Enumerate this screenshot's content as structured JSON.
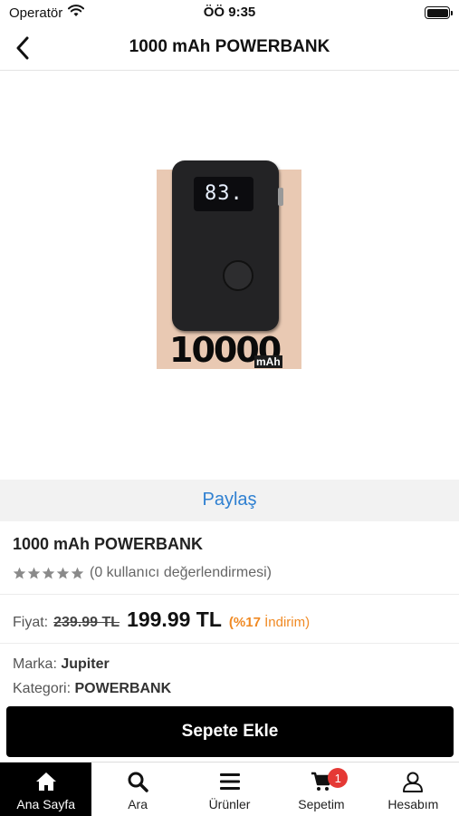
{
  "status_bar": {
    "carrier": "Operatör",
    "time": "ÖÖ 9:35"
  },
  "nav": {
    "title": "1000 mAh POWERBANK"
  },
  "product_image": {
    "display_reading": "83.",
    "box_text": "10000",
    "box_unit": "mAh"
  },
  "share": {
    "label": "Paylaş"
  },
  "product": {
    "name": "1000 mAh POWERBANK",
    "rating_text": "(0 kullanıcı değerlendirmesi)",
    "stars_filled": 0,
    "stars_total": 5,
    "price_label": "Fiyat:",
    "old_price": "239.99 TL",
    "new_price": "199.99 TL",
    "discount_percent": "(%17",
    "discount_word": "İndirim)",
    "brand_label": "Marka:",
    "brand": "Jupiter",
    "category_label": "Kategori:",
    "category": "POWERBANK"
  },
  "actions": {
    "add_to_cart": "Sepete Ekle"
  },
  "tabs": [
    {
      "label": "Ana Sayfa",
      "icon": "home-icon",
      "active": true
    },
    {
      "label": "Ara",
      "icon": "search-icon",
      "active": false
    },
    {
      "label": "Ürünler",
      "icon": "menu-icon",
      "active": false
    },
    {
      "label": "Sepetim",
      "icon": "cart-icon",
      "active": false,
      "badge": "1"
    },
    {
      "label": "Hesabım",
      "icon": "user-icon",
      "active": false
    }
  ],
  "colors": {
    "accent_link": "#2f80d1",
    "discount": "#f08a24",
    "badge": "#e53935",
    "primary_button": "#000000"
  }
}
